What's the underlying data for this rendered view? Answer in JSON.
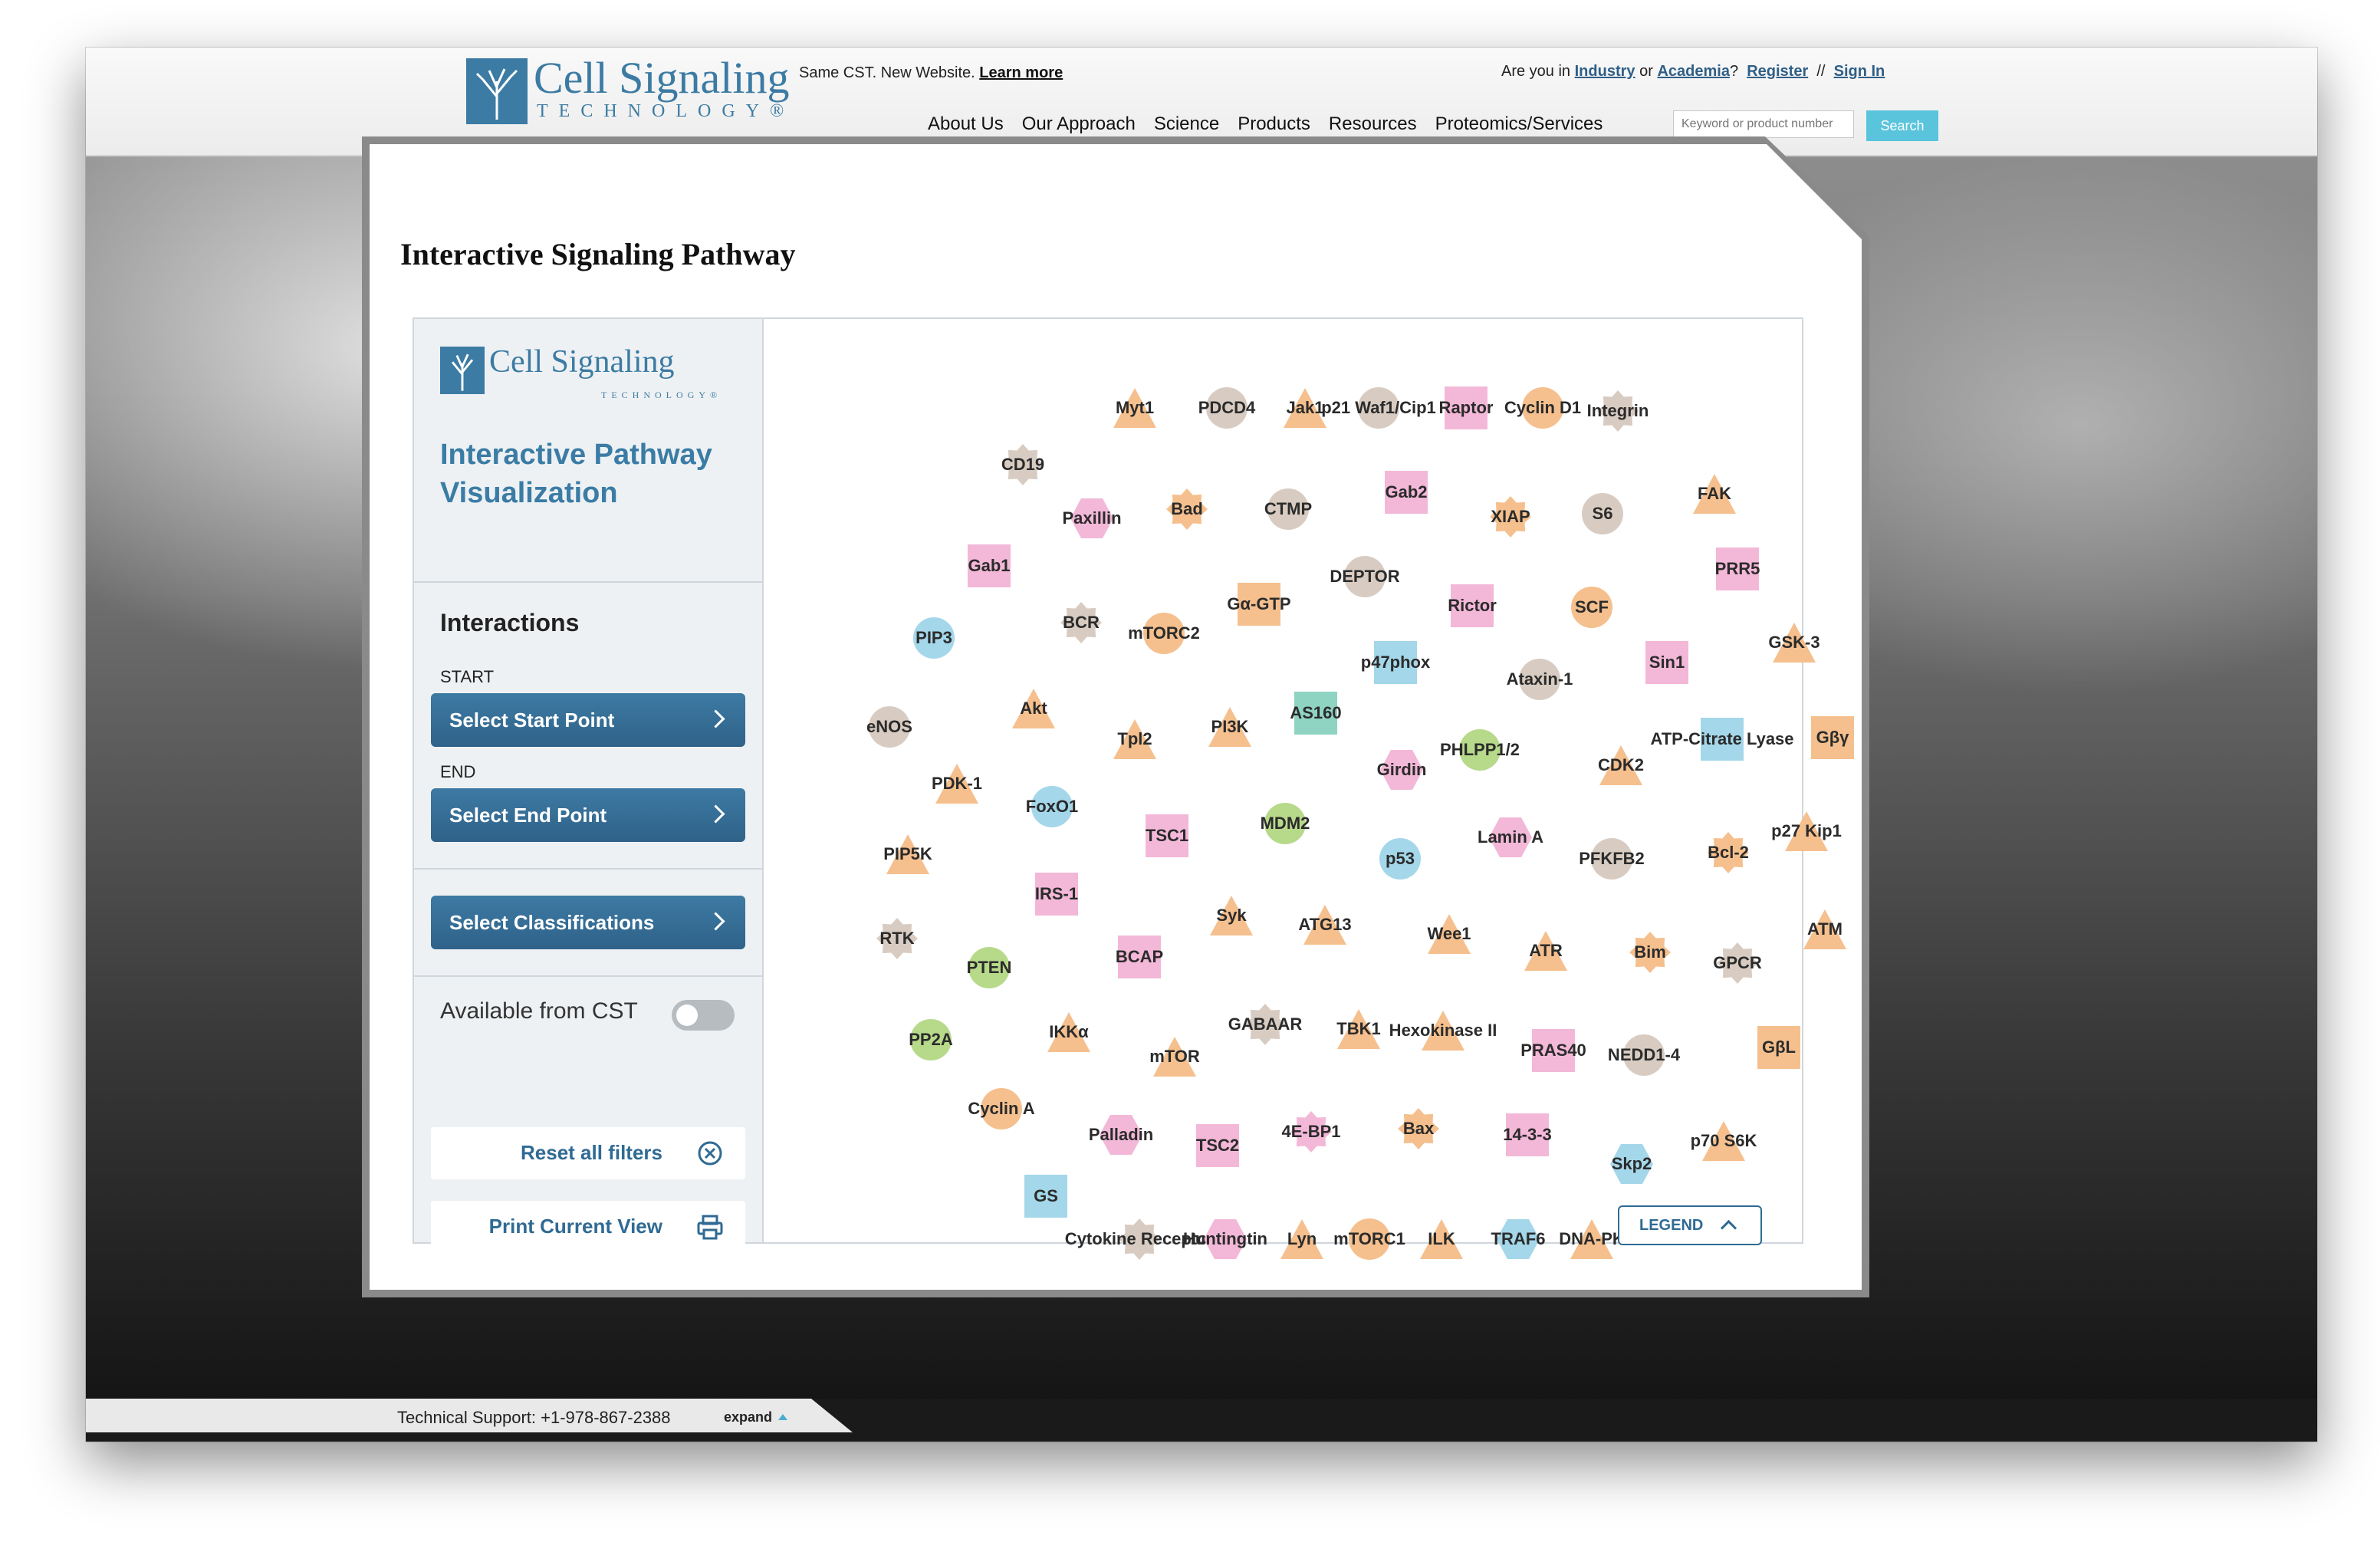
{
  "header": {
    "logo_text": "Cell Signaling",
    "logo_sub": "TECHNOLOGY®",
    "promo_text": "Same CST. New Website.",
    "promo_link": "Learn more",
    "account": {
      "prefix": "Are you in",
      "industry": "Industry",
      "or": "or",
      "academia": "Academia",
      "qmark": "?",
      "register": "Register",
      "sep": "//",
      "sign_in": "Sign In"
    },
    "nav": [
      "About Us",
      "Our Approach",
      "Science",
      "Products",
      "Resources",
      "Proteomics/Services"
    ],
    "search_placeholder": "Keyword or product number",
    "search_button": "Search"
  },
  "card": {
    "title": "Interactive Signaling Pathway"
  },
  "sidebar": {
    "logo_text": "Cell Signaling",
    "logo_sub": "TECHNOLOGY®",
    "heading": "Interactive Pathway Visualization",
    "interactions_title": "Interactions",
    "start_label": "START",
    "start_button": "Select Start Point",
    "end_label": "END",
    "end_button": "Select End Point",
    "classifications_button": "Select Classifications",
    "available_label": "Available from CST",
    "available_on": false,
    "reset_button": "Reset all filters",
    "print_button": "Print Current View"
  },
  "legend_button": "LEGEND",
  "footer": {
    "support_text": "Technical Support: +1-978-867-2388",
    "expand_label": "expand"
  },
  "colors": {
    "brand_blue": "#3c7ba3",
    "search_teal": "#5bc4dd",
    "node_orange": "#f5c08e",
    "node_pink": "#f3b8d8",
    "node_blue": "#a4d7ea",
    "node_green": "#b7d98a",
    "node_gray": "#d8ccc2",
    "node_teal": "#8fd4c2"
  },
  "nodes": [
    {
      "label": "Myt1",
      "shape": "triangle",
      "color": "orange"
    },
    {
      "label": "PDCD4",
      "shape": "circle",
      "color": "gray"
    },
    {
      "label": "Jak1",
      "shape": "triangle",
      "color": "orange"
    },
    {
      "label": "p21 Waf1/Cip1",
      "shape": "circle",
      "color": "gray"
    },
    {
      "label": "Raptor",
      "shape": "square",
      "color": "pink"
    },
    {
      "label": "Cyclin D1",
      "shape": "circle",
      "color": "orange"
    },
    {
      "label": "Integrin",
      "shape": "star",
      "color": "gray"
    },
    {
      "label": "CD19",
      "shape": "star",
      "color": "gray"
    },
    {
      "label": "Gab2",
      "shape": "square",
      "color": "pink"
    },
    {
      "label": "FAK",
      "shape": "triangle",
      "color": "orange"
    },
    {
      "label": "Paxillin",
      "shape": "hexagon",
      "color": "pink"
    },
    {
      "label": "Bad",
      "shape": "star",
      "color": "orange"
    },
    {
      "label": "CTMP",
      "shape": "circle",
      "color": "gray"
    },
    {
      "label": "XIAP",
      "shape": "star",
      "color": "orange"
    },
    {
      "label": "S6",
      "shape": "circle",
      "color": "gray"
    },
    {
      "label": "Gab1",
      "shape": "square",
      "color": "pink"
    },
    {
      "label": "DEPTOR",
      "shape": "circle",
      "color": "gray"
    },
    {
      "label": "PRR5",
      "shape": "square",
      "color": "pink"
    },
    {
      "label": "Gα-GTP",
      "shape": "square",
      "color": "orange"
    },
    {
      "label": "Rictor",
      "shape": "square",
      "color": "pink"
    },
    {
      "label": "SCF",
      "shape": "circle",
      "color": "orange"
    },
    {
      "label": "BCR",
      "shape": "star",
      "color": "gray"
    },
    {
      "label": "mTORC2",
      "shape": "circle",
      "color": "orange"
    },
    {
      "label": "PIP3",
      "shape": "circle",
      "color": "blue"
    },
    {
      "label": "p47phox",
      "shape": "square",
      "color": "blue"
    },
    {
      "label": "Sin1",
      "shape": "square",
      "color": "pink"
    },
    {
      "label": "GSK-3",
      "shape": "triangle",
      "color": "orange"
    },
    {
      "label": "Ataxin-1",
      "shape": "circle",
      "color": "gray"
    },
    {
      "label": "AS160",
      "shape": "square",
      "color": "teal"
    },
    {
      "label": "Akt",
      "shape": "triangle",
      "color": "orange"
    },
    {
      "label": "eNOS",
      "shape": "circle",
      "color": "gray"
    },
    {
      "label": "PI3K",
      "shape": "triangle",
      "color": "orange"
    },
    {
      "label": "Tpl2",
      "shape": "triangle",
      "color": "orange"
    },
    {
      "label": "ATP-Citrate Lyase",
      "shape": "square",
      "color": "blue"
    },
    {
      "label": "Gβγ",
      "shape": "square",
      "color": "orange"
    },
    {
      "label": "PHLPP1/2",
      "shape": "circle",
      "color": "green"
    },
    {
      "label": "Girdin",
      "shape": "hexagon",
      "color": "pink"
    },
    {
      "label": "CDK2",
      "shape": "triangle",
      "color": "orange"
    },
    {
      "label": "PDK-1",
      "shape": "triangle",
      "color": "orange"
    },
    {
      "label": "FoxO1",
      "shape": "circle",
      "color": "blue"
    },
    {
      "label": "MDM2",
      "shape": "circle",
      "color": "green"
    },
    {
      "label": "TSC1",
      "shape": "square",
      "color": "pink"
    },
    {
      "label": "p27 Kip1",
      "shape": "triangle",
      "color": "orange"
    },
    {
      "label": "Lamin A",
      "shape": "hexagon",
      "color": "pink"
    },
    {
      "label": "Bcl-2",
      "shape": "star",
      "color": "orange"
    },
    {
      "label": "PIP5K",
      "shape": "triangle",
      "color": "orange"
    },
    {
      "label": "p53",
      "shape": "circle",
      "color": "blue"
    },
    {
      "label": "PFKFB2",
      "shape": "circle",
      "color": "gray"
    },
    {
      "label": "IRS-1",
      "shape": "square",
      "color": "pink"
    },
    {
      "label": "Syk",
      "shape": "triangle",
      "color": "orange"
    },
    {
      "label": "ATG13",
      "shape": "triangle",
      "color": "orange"
    },
    {
      "label": "Wee1",
      "shape": "triangle",
      "color": "orange"
    },
    {
      "label": "RTK",
      "shape": "star",
      "color": "gray"
    },
    {
      "label": "ATR",
      "shape": "triangle",
      "color": "orange"
    },
    {
      "label": "Bim",
      "shape": "star",
      "color": "orange"
    },
    {
      "label": "ATM",
      "shape": "triangle",
      "color": "orange"
    },
    {
      "label": "BCAP",
      "shape": "square",
      "color": "pink"
    },
    {
      "label": "GPCR",
      "shape": "star",
      "color": "gray"
    },
    {
      "label": "PTEN",
      "shape": "circle",
      "color": "green"
    },
    {
      "label": "GABAAR",
      "shape": "star",
      "color": "gray"
    },
    {
      "label": "TBK1",
      "shape": "triangle",
      "color": "orange"
    },
    {
      "label": "IKKα",
      "shape": "triangle",
      "color": "orange"
    },
    {
      "label": "Hexokinase II",
      "shape": "triangle",
      "color": "orange"
    },
    {
      "label": "PRAS40",
      "shape": "square",
      "color": "pink"
    },
    {
      "label": "GβL",
      "shape": "square",
      "color": "orange"
    },
    {
      "label": "PP2A",
      "shape": "circle",
      "color": "green"
    },
    {
      "label": "mTOR",
      "shape": "triangle",
      "color": "orange"
    },
    {
      "label": "NEDD1-4",
      "shape": "circle",
      "color": "gray"
    },
    {
      "label": "Cyclin A",
      "shape": "circle",
      "color": "orange"
    },
    {
      "label": "Palladin",
      "shape": "hexagon",
      "color": "pink"
    },
    {
      "label": "4E-BP1",
      "shape": "star",
      "color": "pink"
    },
    {
      "label": "Bax",
      "shape": "star",
      "color": "orange"
    },
    {
      "label": "14-3-3",
      "shape": "square",
      "color": "pink"
    },
    {
      "label": "TSC2",
      "shape": "square",
      "color": "pink"
    },
    {
      "label": "p70 S6K",
      "shape": "triangle",
      "color": "orange"
    },
    {
      "label": "Skp2",
      "shape": "hexagon",
      "color": "blue"
    },
    {
      "label": "GS",
      "shape": "square",
      "color": "blue"
    },
    {
      "label": "Cytokine Receptor",
      "shape": "star",
      "color": "gray"
    },
    {
      "label": "Huntingtin",
      "shape": "hexagon",
      "color": "pink"
    },
    {
      "label": "Lyn",
      "shape": "triangle",
      "color": "orange"
    },
    {
      "label": "mTORC1",
      "shape": "circle",
      "color": "orange"
    },
    {
      "label": "ILK",
      "shape": "triangle",
      "color": "orange"
    },
    {
      "label": "TRAF6",
      "shape": "hexagon",
      "color": "blue"
    },
    {
      "label": "DNA-PK",
      "shape": "triangle",
      "color": "orange"
    }
  ]
}
